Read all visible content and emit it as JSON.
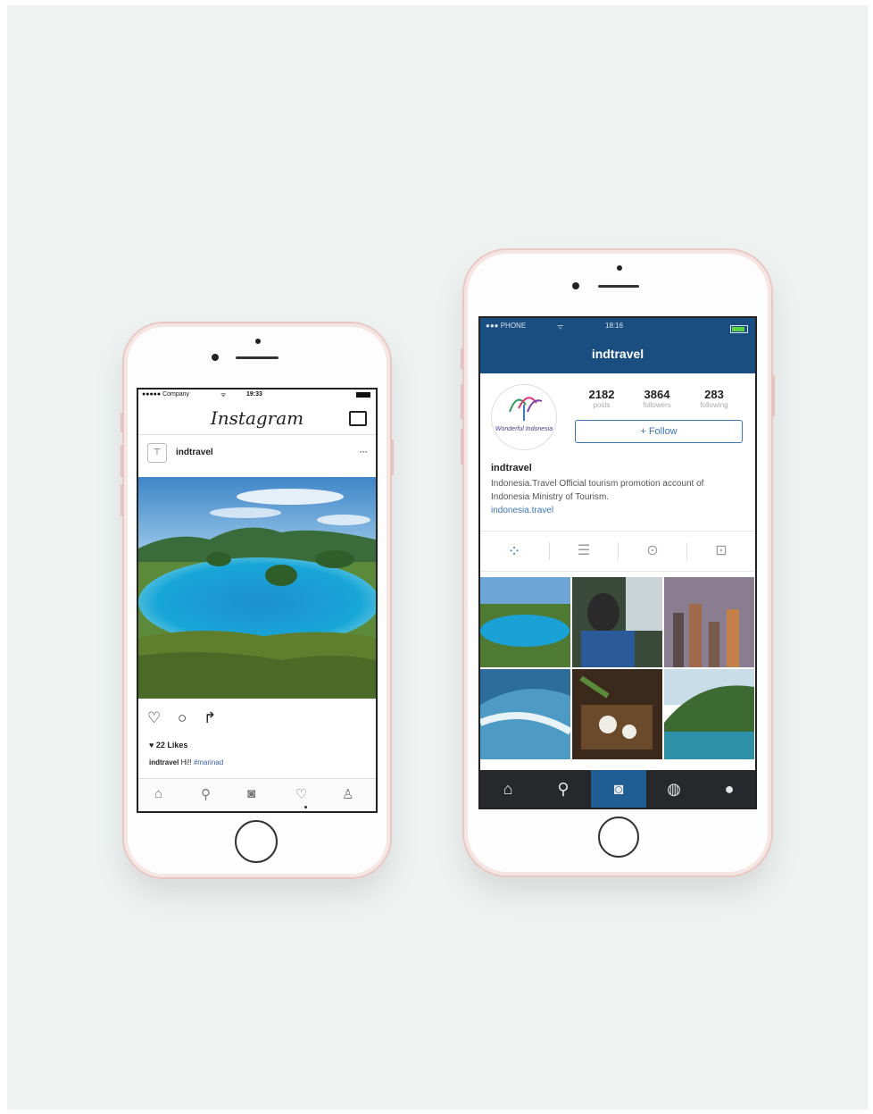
{
  "phone1": {
    "status": {
      "carrier": "●●●●● Company",
      "wifi": "ᯤ",
      "time": "19:33"
    },
    "header": {
      "logo": "Instagram",
      "inbox_icon": "inbox-icon"
    },
    "post": {
      "username": "indtravel",
      "avatar_glyph": "⊤",
      "more": "···",
      "actions": {
        "like": "♡",
        "comment": "○",
        "share": "↱"
      },
      "likes": "♥ 22 Likes",
      "caption_user": "indtravel",
      "caption_text": "Hi!!",
      "caption_tag": "#marinad"
    },
    "tabbar": {
      "home": "⌂",
      "search": "⚲",
      "camera": "◙",
      "activity": "♡",
      "profile": "♙"
    }
  },
  "phone2": {
    "status": {
      "carrier": "●●● PHONE",
      "wifi": "ᯤ",
      "time": "18:16"
    },
    "title": "indtravel",
    "logo_text": "Wonderful Indonesia",
    "stats": {
      "posts": {
        "value": "2182",
        "label": "posts"
      },
      "followers": {
        "value": "3864",
        "label": "followers"
      },
      "following": {
        "value": "283",
        "label": "following"
      }
    },
    "follow_label": "+ Follow",
    "bio": {
      "name": "indtravel",
      "text": "Indonesia.Travel Official tourism promotion account of Indonesia Ministry of Tourism.",
      "link": "indonesia.travel"
    },
    "tabs": {
      "grid": "⁘",
      "list": "☰",
      "location": "⊙",
      "tagged": "⊡"
    },
    "nav": {
      "home": "⌂",
      "search": "⚲",
      "camera": "◙",
      "activity": "◍",
      "profile": "●"
    },
    "colors": {
      "header": "#1a4e80",
      "nav": "#26282b",
      "nav_active": "#1f5d92",
      "link": "#3c76b5"
    }
  }
}
